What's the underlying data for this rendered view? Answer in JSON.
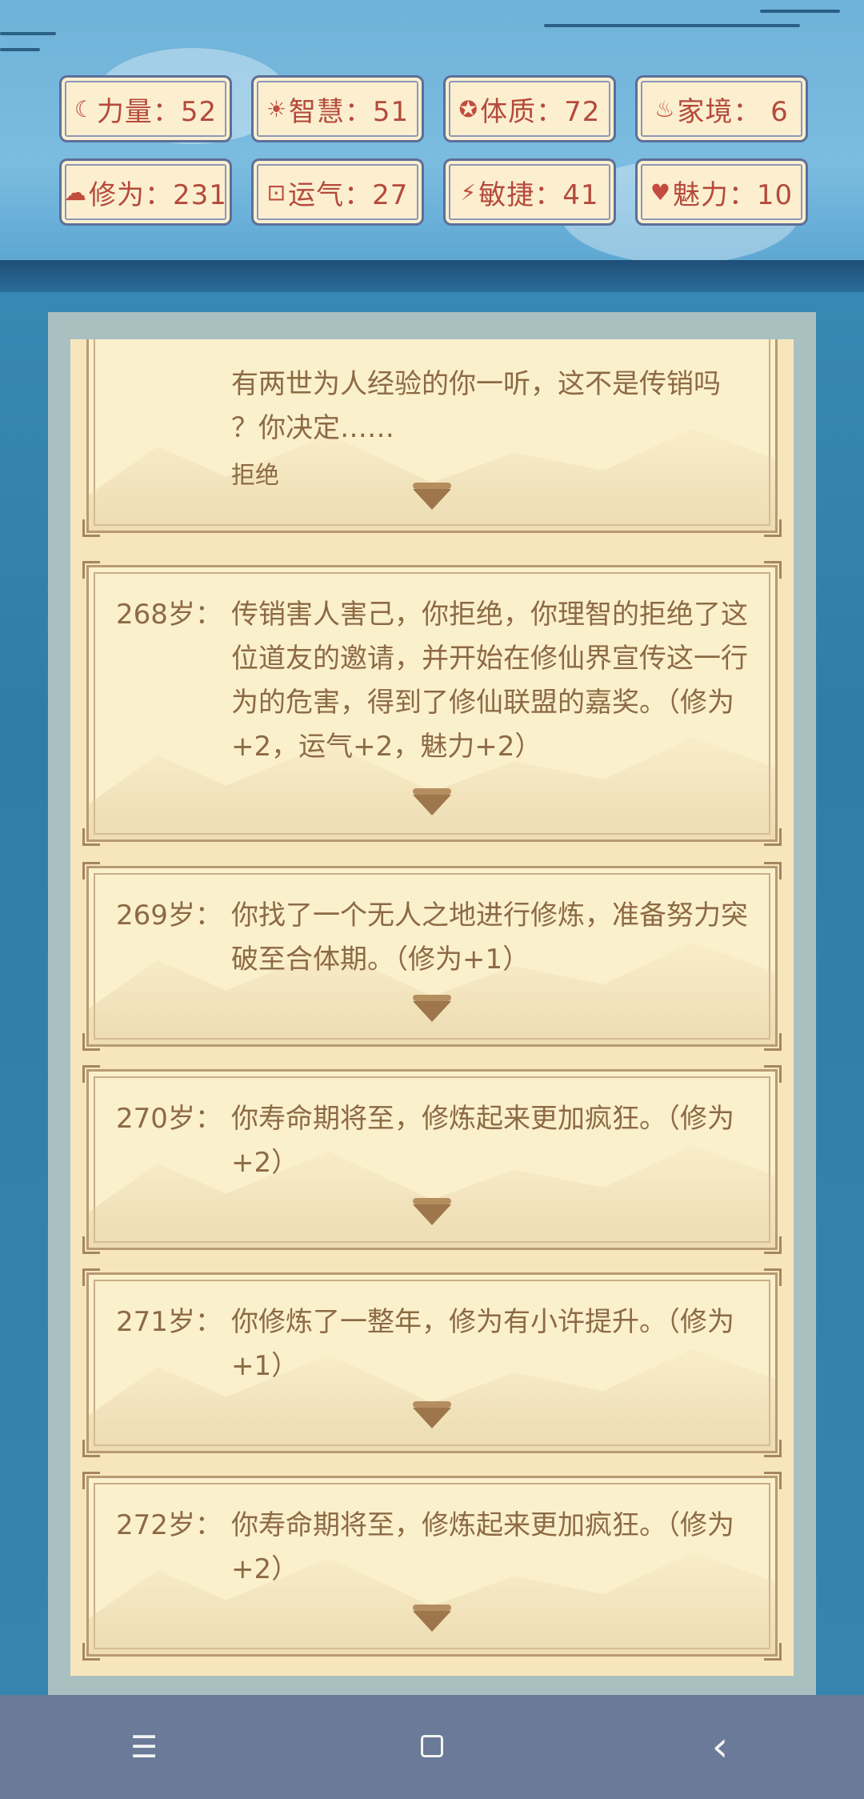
{
  "stats": [
    {
      "icon": "fist-icon",
      "glyph": "☾",
      "label": "力量：52"
    },
    {
      "icon": "bulb-icon",
      "glyph": "☀",
      "label": "智慧：51"
    },
    {
      "icon": "shield-icon",
      "glyph": "✪",
      "label": "体质：72"
    },
    {
      "icon": "money-bag-icon",
      "glyph": "♨",
      "label": "家境： 6"
    },
    {
      "icon": "cloud-icon",
      "glyph": "☁",
      "label": "修为：231"
    },
    {
      "icon": "dice-icon",
      "glyph": "⊡",
      "label": "运气：27"
    },
    {
      "icon": "lightning-icon",
      "glyph": "⚡",
      "label": "敏捷：41"
    },
    {
      "icon": "heart-icon",
      "glyph": "♥",
      "label": "魅力：10"
    }
  ],
  "partial_event": {
    "lines": [
      "有两世为人经验的你一听，这不是传销吗",
      "？你决定……"
    ],
    "choice": "拒绝"
  },
  "events": [
    {
      "age": "268岁：",
      "text": "传销害人害己，你拒绝，你理智的拒绝了这位道友的邀请，并开始在修仙界宣传这一行为的危害，得到了修仙联盟的嘉奖。（修为+2，运气+2，魅力+2）"
    },
    {
      "age": "269岁：",
      "text": "你找了一个无人之地进行修炼，准备努力突破至合体期。（修为+1）"
    },
    {
      "age": "270岁：",
      "text": "你寿命期将至，修炼起来更加疯狂。（修为+2）"
    },
    {
      "age": "271岁：",
      "text": "你修炼了一整年，修为有小许提升。（修为+1）"
    },
    {
      "age": "272岁：",
      "text": "你寿命期将至，修炼起来更加疯狂。（修为+2）"
    }
  ],
  "nav": {
    "menu": "☰",
    "back": "‹"
  }
}
